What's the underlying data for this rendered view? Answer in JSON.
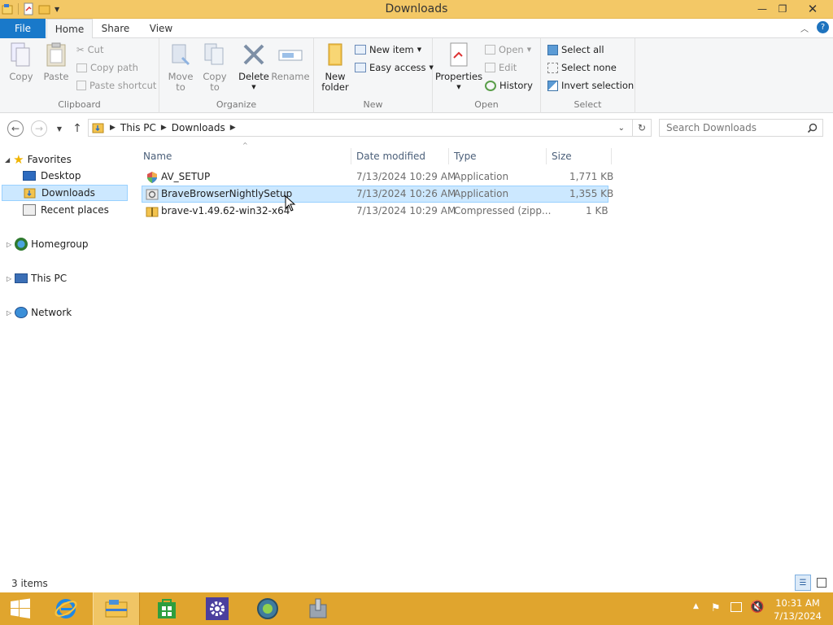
{
  "window": {
    "title": "Downloads"
  },
  "tabs": {
    "file": "File",
    "home": "Home",
    "share": "Share",
    "view": "View"
  },
  "ribbon": {
    "clipboard": {
      "label": "Clipboard",
      "copy": "Copy",
      "paste": "Paste",
      "cut": "Cut",
      "copy_path": "Copy path",
      "paste_shortcut": "Paste shortcut"
    },
    "organize": {
      "label": "Organize",
      "move_to_1": "Move",
      "move_to_2": "to",
      "copy_to_1": "Copy",
      "copy_to_2": "to",
      "delete": "Delete",
      "rename": "Rename"
    },
    "new": {
      "label": "New",
      "new_folder_1": "New",
      "new_folder_2": "folder",
      "new_item": "New item",
      "easy_access": "Easy access"
    },
    "open": {
      "label": "Open",
      "properties": "Properties",
      "open": "Open",
      "edit": "Edit",
      "history": "History"
    },
    "select": {
      "label": "Select",
      "select_all": "Select all",
      "select_none": "Select none",
      "invert_selection": "Invert selection"
    }
  },
  "address": {
    "crumbs": [
      "This PC",
      "Downloads"
    ],
    "search_placeholder": "Search Downloads"
  },
  "nav": {
    "favorites": "Favorites",
    "desktop": "Desktop",
    "downloads": "Downloads",
    "recent_places": "Recent places",
    "homegroup": "Homegroup",
    "this_pc": "This PC",
    "network": "Network"
  },
  "columns": {
    "name": "Name",
    "date_modified": "Date modified",
    "type": "Type",
    "size": "Size"
  },
  "files": [
    {
      "name": "AV_SETUP",
      "date": "7/13/2024 10:29 AM",
      "type": "Application",
      "size": "1,771 KB"
    },
    {
      "name": "BraveBrowserNightlySetup",
      "date": "7/13/2024 10:26 AM",
      "type": "Application",
      "size": "1,355 KB"
    },
    {
      "name": "brave-v1.49.62-win32-x64",
      "date": "7/13/2024 10:29 AM",
      "type": "Compressed (zipp...",
      "size": "1 KB"
    }
  ],
  "status": {
    "items": "3 items"
  },
  "taskbar": {
    "time": "10:31 AM",
    "date": "7/13/2024"
  },
  "colors": {
    "titlebar": "#f3c866",
    "file_tab": "#1979ca",
    "taskbar": "#e0a52e",
    "selection": "#cce8ff"
  }
}
